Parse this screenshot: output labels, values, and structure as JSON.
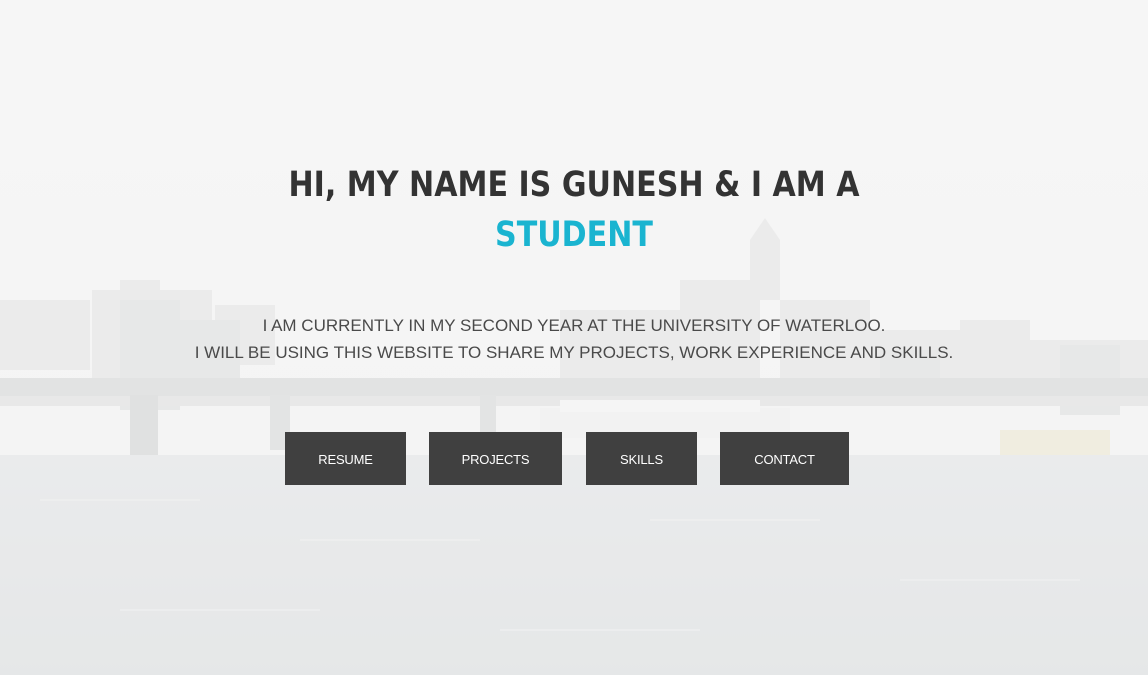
{
  "hero": {
    "headline_line1": "HI, MY NAME IS GUNESH & I AM A",
    "headline_role": "STUDENT",
    "intro_line1": "I AM CURRENTLY IN MY SECOND YEAR AT THE UNIVERSITY OF WATERLOO.",
    "intro_line2": "I WILL BE USING THIS WEBSITE TO SHARE MY PROJECTS, WORK EXPERIENCE AND SKILLS."
  },
  "nav_buttons": {
    "resume": "RESUME",
    "projects": "PROJECTS",
    "skills": "SKILLS",
    "contact": "CONTACT"
  },
  "colors": {
    "accent": "#1ab4d0",
    "heading": "#333333",
    "button_bg": "#404040",
    "button_text": "#ffffff"
  }
}
